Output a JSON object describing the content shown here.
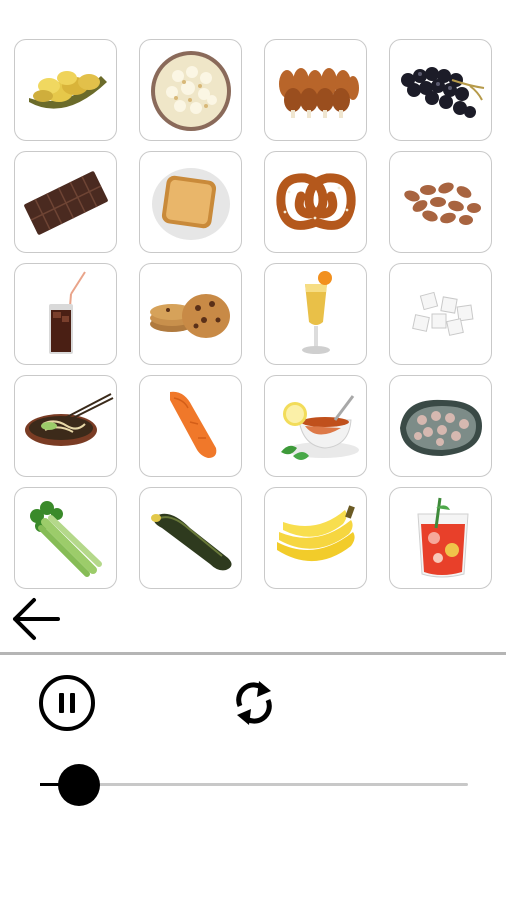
{
  "tiles": [
    {
      "id": "chips"
    },
    {
      "id": "popcorn"
    },
    {
      "id": "chicken-legs"
    },
    {
      "id": "grapes"
    },
    {
      "id": "chocolate-bar"
    },
    {
      "id": "toast"
    },
    {
      "id": "pretzel"
    },
    {
      "id": "almonds"
    },
    {
      "id": "cola-drink"
    },
    {
      "id": "cookies"
    },
    {
      "id": "juice-glass"
    },
    {
      "id": "sugar-cubes"
    },
    {
      "id": "noodle-soup"
    },
    {
      "id": "carrot"
    },
    {
      "id": "tea-cup"
    },
    {
      "id": "candy-plate"
    },
    {
      "id": "celery"
    },
    {
      "id": "cucumber"
    },
    {
      "id": "bananas"
    },
    {
      "id": "fruit-punch"
    }
  ],
  "controls": {
    "back_icon": "arrow-left-icon",
    "pause_icon": "pause-circle-icon",
    "repeat_icon": "repeat-icon"
  },
  "slider": {
    "value": 0.09
  }
}
